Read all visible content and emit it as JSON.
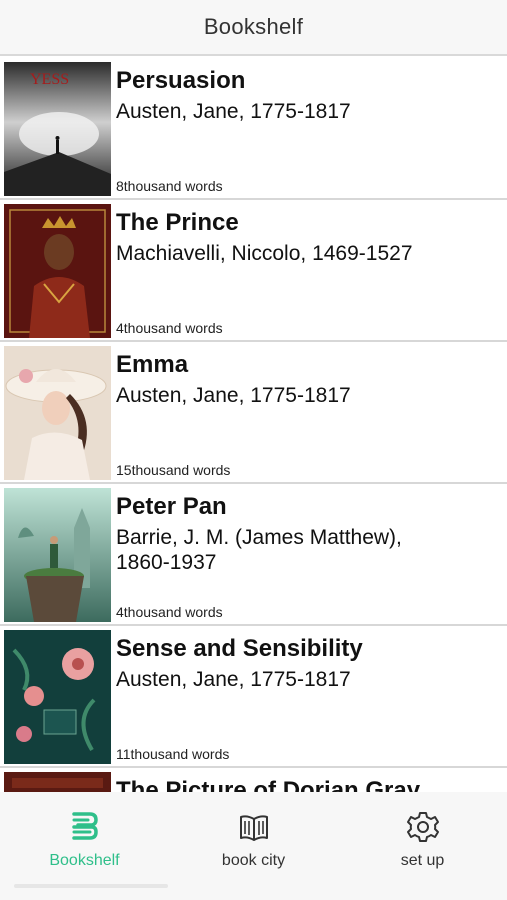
{
  "header": {
    "title": "Bookshelf"
  },
  "books": [
    {
      "title": "Persuasion",
      "author": "Austen, Jane, 1775-1817",
      "words": "8thousand words",
      "cover_icon": "persuasion-cover"
    },
    {
      "title": "The Prince",
      "author": "Machiavelli, Niccolo, 1469-1527",
      "words": "4thousand words",
      "cover_icon": "prince-cover"
    },
    {
      "title": "Emma",
      "author": "Austen, Jane, 1775-1817",
      "words": "15thousand words",
      "cover_icon": "emma-cover"
    },
    {
      "title": "Peter Pan",
      "author": "Barrie, J. M. (James Matthew),\n 1860-1937",
      "words": "4thousand words",
      "cover_icon": "peter-pan-cover"
    },
    {
      "title": "Sense and Sensibility",
      "author": "Austen, Jane, 1775-1817",
      "words": "11thousand words",
      "cover_icon": "sense-cover"
    },
    {
      "title": "The Picture of Dorian Gray",
      "author": "",
      "words": "",
      "cover_icon": "dorian-cover"
    }
  ],
  "nav": {
    "bookshelf": "Bookshelf",
    "book_city": "book city",
    "set_up": "set up"
  },
  "colors": {
    "accent": "#2fbf8a",
    "nav_bg": "#f7f7f7",
    "divider": "#d7d7d7"
  }
}
